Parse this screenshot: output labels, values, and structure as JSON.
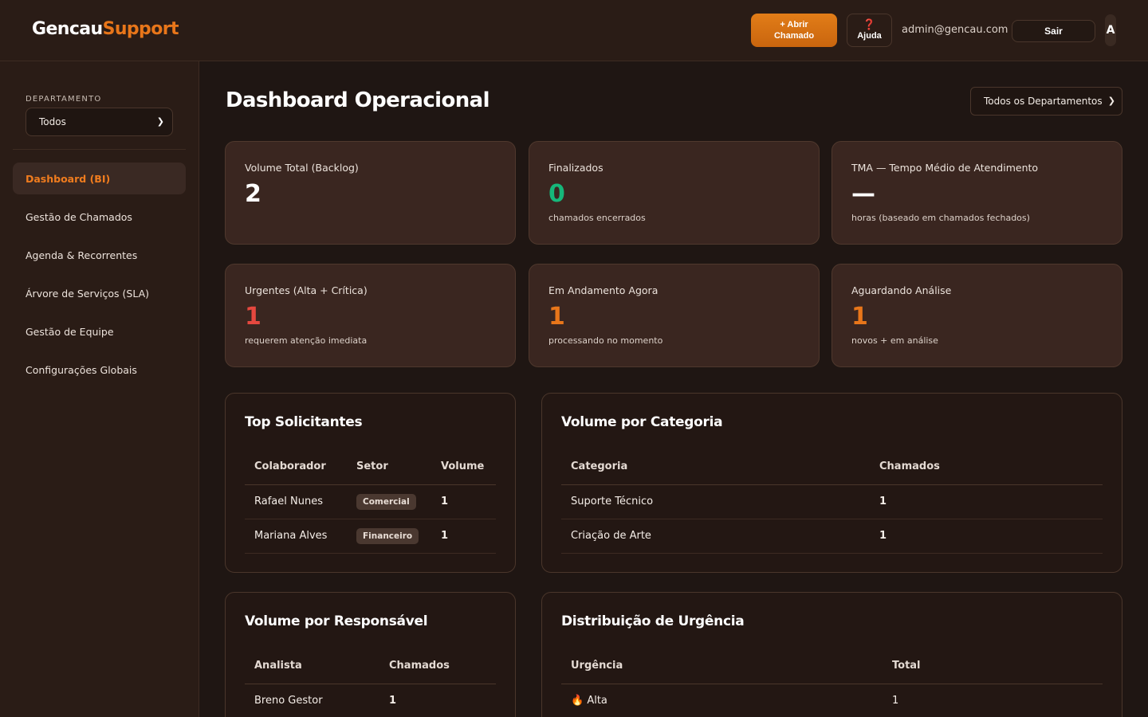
{
  "header": {
    "logo_part1": "Gencau",
    "logo_part2": "Support",
    "open_ticket_line1": "+ Abrir",
    "open_ticket_line2": "Chamado",
    "help_icon": "❓",
    "help_label": "Ajuda",
    "user_email": "admin@gencau.com",
    "logout_label": "Sair",
    "avatar_initial": "A"
  },
  "sidebar": {
    "department_label": "DEPARTAMENTO",
    "department_value": "Todos",
    "items": [
      {
        "label": "Dashboard (BI)",
        "active": true
      },
      {
        "label": "Gestão de Chamados"
      },
      {
        "label": "Agenda & Recorrentes"
      },
      {
        "label": "Árvore de Serviços (SLA)"
      },
      {
        "label": "Gestão de Equipe"
      },
      {
        "label": "Configurações Globais"
      }
    ]
  },
  "main": {
    "title": "Dashboard Operacional",
    "filter_value": "Todos os Departamentos",
    "kpis": [
      {
        "label": "Volume Total (Backlog)",
        "value": "2",
        "sub": "",
        "color": "#ffffff"
      },
      {
        "label": "Finalizados",
        "value": "0",
        "sub": "chamados encerrados",
        "color": "#16b77a"
      },
      {
        "label": "TMA — Tempo Médio de Atendimento",
        "value": "—",
        "sub": "horas (baseado em chamados fechados)",
        "color": "#ffffff"
      },
      {
        "label": "Urgentes (Alta + Crítica)",
        "value": "1",
        "sub": "requerem atenção imediata",
        "color": "#e5483f"
      },
      {
        "label": "Em Andamento Agora",
        "value": "1",
        "sub": "processando no momento",
        "color": "#e8761a"
      },
      {
        "label": "Aguardando Análise",
        "value": "1",
        "sub": "novos + em análise",
        "color": "#e8761a"
      }
    ],
    "top_requesters": {
      "title": "Top Solicitantes",
      "headers": [
        "Colaborador",
        "Setor",
        "Volume"
      ],
      "rows": [
        {
          "name": "Rafael Nunes",
          "sector": "Comercial",
          "volume": "1"
        },
        {
          "name": "Mariana Alves",
          "sector": "Financeiro",
          "volume": "1"
        }
      ]
    },
    "by_category": {
      "title": "Volume por Categoria",
      "headers": [
        "Categoria",
        "Chamados"
      ],
      "rows": [
        {
          "category": "Suporte Técnico",
          "count": "1"
        },
        {
          "category": "Criação de Arte",
          "count": "1"
        }
      ]
    },
    "by_owner": {
      "title": "Volume por Responsável",
      "headers": [
        "Analista",
        "Chamados"
      ],
      "rows": [
        {
          "analyst": "Breno Gestor",
          "count": "1"
        }
      ]
    },
    "urgency": {
      "title": "Distribuição de Urgência",
      "headers": [
        "Urgência",
        "Total"
      ],
      "rows": [
        {
          "icon": "🔥",
          "level": "Alta",
          "total": "1"
        }
      ]
    }
  }
}
